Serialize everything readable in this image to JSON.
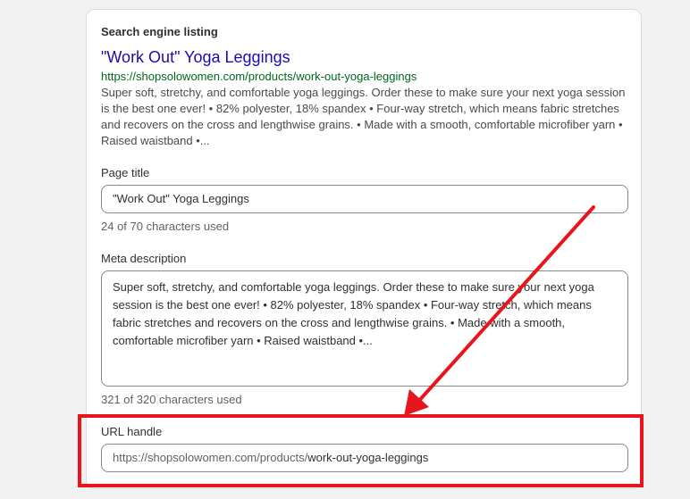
{
  "section": {
    "title": "Search engine listing"
  },
  "preview": {
    "title": "\"Work Out\" Yoga Leggings",
    "url": "https://shopsolowomen.com/products/work-out-yoga-leggings",
    "description": "Super soft, stretchy, and comfortable yoga leggings. Order these to make sure your next yoga session is the best one ever! • 82% polyester, 18% spandex • Four-way stretch, which means fabric stretches and recovers on the cross and lengthwise grains. • Made with a smooth, comfortable microfiber yarn • Raised waistband •..."
  },
  "page_title": {
    "label": "Page title",
    "value": "\"Work Out\" Yoga Leggings",
    "helper": "24 of 70 characters used"
  },
  "meta_description": {
    "label": "Meta description",
    "value": "Super soft, stretchy, and comfortable yoga leggings. Order these to make sure your next yoga session is the best one ever! • 82% polyester, 18% spandex • Four-way stretch, which means fabric stretches and recovers on the cross and lengthwise grains. • Made with a smooth, comfortable microfiber yarn • Raised waistband •...",
    "helper": "321 of 320 characters used"
  },
  "url_handle": {
    "label": "URL handle",
    "prefix": "https://shopsolowomen.com/products/",
    "value": "work-out-yoga-leggings"
  },
  "annotation": {
    "color": "#e8161c",
    "icon": "arrow-annotation-icon"
  }
}
